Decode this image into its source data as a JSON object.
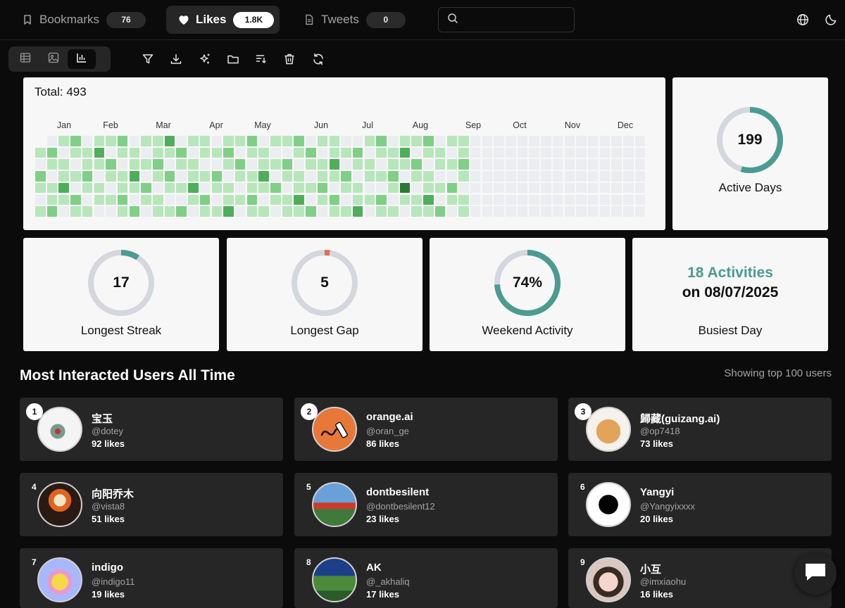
{
  "nav": {
    "tabs": [
      {
        "label": "Bookmarks",
        "count": "76",
        "icon": "bookmark-icon",
        "active": false
      },
      {
        "label": "Likes",
        "count": "1.8K",
        "icon": "heart-icon",
        "active": true
      },
      {
        "label": "Tweets",
        "count": "0",
        "icon": "document-icon",
        "active": false
      }
    ],
    "search": {
      "placeholder": "",
      "value": ""
    },
    "icons": [
      "globe-icon",
      "moon-icon"
    ]
  },
  "toolbar": {
    "view_modes": [
      "table-view-icon",
      "gallery-view-icon",
      "chart-view-icon"
    ],
    "active_view": "chart-view-icon",
    "tools": [
      "filter-icon",
      "download-icon",
      "sparkle-icon",
      "folder-icon",
      "sort-icon",
      "trash-icon",
      "refresh-icon"
    ]
  },
  "heatmap": {
    "total_label": "Total: 493",
    "months": [
      "Jan",
      "Feb",
      "Mar",
      "Apr",
      "May",
      "Jun",
      "Jul",
      "Aug",
      "Sep",
      "Oct",
      "Nov",
      "Dec"
    ],
    "colors": {
      "empty": "#ebedf0",
      "l1": "#b7e6ba",
      "l2": "#7fcf86",
      "l3": "#4fae5a",
      "l4": "#2b7a36"
    }
  },
  "stats": {
    "active_days": {
      "value": "199",
      "label": "Active Days",
      "fraction": 0.545,
      "color": "#4b9b92"
    },
    "longest_streak": {
      "value": "17",
      "label": "Longest Streak",
      "fraction": 0.093,
      "color": "#4b9b92"
    },
    "longest_gap": {
      "value": "5",
      "label": "Longest Gap",
      "fraction": 0.027,
      "color": "#e46d52"
    },
    "weekend_activity": {
      "value": "74%",
      "label": "Weekend Activity",
      "fraction": 0.74,
      "color": "#4b9b92"
    },
    "busiest_day": {
      "activities": "18 Activities",
      "date": "on 08/07/2025",
      "label": "Busiest Day"
    }
  },
  "users_section": {
    "title": "Most Interacted Users All Time",
    "note": "Showing top 100 users",
    "users": [
      {
        "rank": "1",
        "name": "宝玉",
        "handle": "@dotey",
        "likes": "92 likes",
        "avatar": "hummingbird-avatar"
      },
      {
        "rank": "2",
        "name": "orange.ai",
        "handle": "@oran_ge",
        "likes": "86 likes",
        "avatar": "orange-pen-avatar"
      },
      {
        "rank": "3",
        "name": "歸藏(guizang.ai)",
        "handle": "@op7418",
        "likes": "73 likes",
        "avatar": "cat-avatar"
      },
      {
        "rank": "4",
        "name": "向阳乔木",
        "handle": "@vista8",
        "likes": "51 likes",
        "avatar": "ghost-rider-avatar"
      },
      {
        "rank": "5",
        "name": "dontbesilent",
        "handle": "@dontbesilent12",
        "likes": "23 likes",
        "avatar": "tower-avatar"
      },
      {
        "rank": "6",
        "name": "Yangyi",
        "handle": "@Yangyixxxx",
        "likes": "20 likes",
        "avatar": "silhouette-avatar"
      },
      {
        "rank": "7",
        "name": "indigo",
        "handle": "@indigo11",
        "likes": "19 likes",
        "avatar": "cartoon-avatar"
      },
      {
        "rank": "8",
        "name": "AK",
        "handle": "@_akhaliq",
        "likes": "17 likes",
        "avatar": "landscape-avatar"
      },
      {
        "rank": "9",
        "name": "小互",
        "handle": "@imxiaohu",
        "likes": "16 likes",
        "avatar": "girl-avatar"
      }
    ]
  },
  "chat_button": {
    "icon": "chat-icon"
  }
}
